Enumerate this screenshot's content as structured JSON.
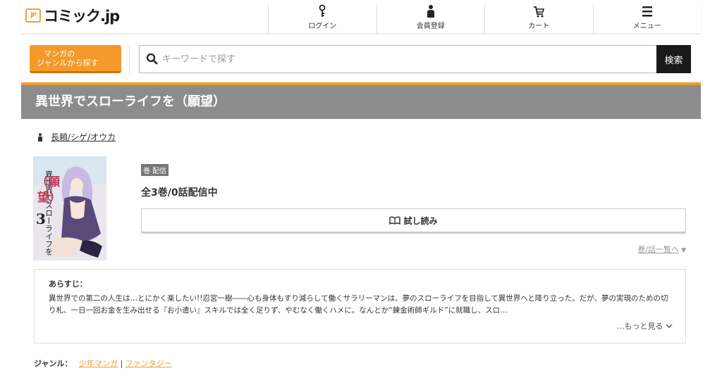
{
  "header": {
    "logo_badge": "JP",
    "logo_text": "コミック.jp",
    "nav": [
      {
        "label": "ログイン",
        "icon": "key-icon"
      },
      {
        "label": "会員登録",
        "icon": "person-icon"
      },
      {
        "label": "カート",
        "icon": "cart-icon"
      },
      {
        "label": "メニュー",
        "icon": "menu-icon"
      }
    ]
  },
  "search": {
    "genre_button_line1": "マンガの",
    "genre_button_line2": "ジャンルから探す",
    "placeholder": "キーワードで探す",
    "button_label": "検索"
  },
  "title": "異世界でスローライフを（願望）",
  "author": "長頼/シゲ/オウカ",
  "book": {
    "badge": "巻 配信",
    "count": "全3巻/0話配信中",
    "trial_label": "試し読み",
    "volume_list_link": "巻/話一覧へ",
    "cover_title": "異世界でスローライフを",
    "cover_subtitle": "願望",
    "cover_volume": "3"
  },
  "synopsis": {
    "heading": "あらすじ：",
    "text": "異世界での第二の人生は…とにかく楽したい!!忍宮一樹――心も身体もすり減らして働くサラリーマンは、夢のスローライフを目指して異世界へと降り立った。だが、夢の実現のための切り札、一日一回お金を生み出せる『お小遣い』スキルでは全く足りず、やむなく働くハメに。なんとか“錬金術師ギルド”に就職し、スロ…",
    "more_label": "…もっと見る"
  },
  "genres": {
    "label": "ジャンル：",
    "items": [
      "少年マンガ",
      "ファンタジー"
    ],
    "separator": "|"
  },
  "colors": {
    "accent": "#f39a2a",
    "title_bar": "#8c8c8c",
    "search_button": "#1a1a1a"
  }
}
